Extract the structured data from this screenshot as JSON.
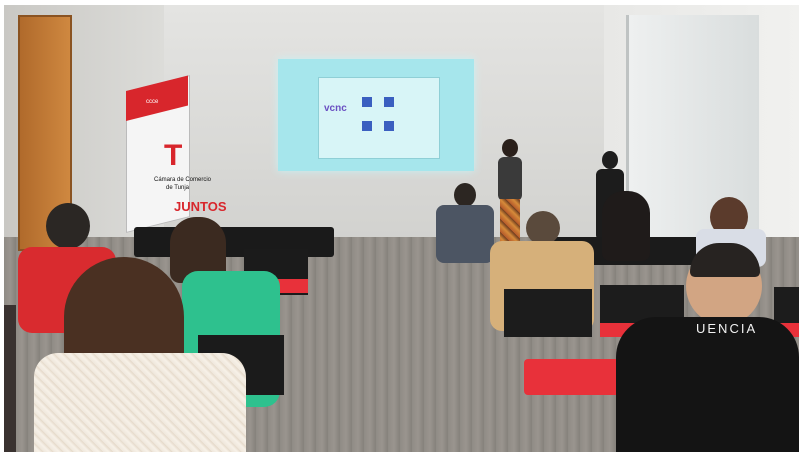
{
  "photo": {
    "banner": {
      "logo_letter": "T",
      "top_text": "ccce",
      "org_line1": "Cámara de Comercio",
      "org_line2": "de Tunja",
      "slogan": "JUNTOS"
    },
    "projection": {
      "logo_text": "vcnc"
    },
    "clothing_text": "UENCIA"
  },
  "colors": {
    "wall": "#d9d9d7",
    "floor": "#8f8b85",
    "screen": "#9fe3ea",
    "banner_red": "#d8262c",
    "chair_red": "#e8313a",
    "door": "#c27a33"
  }
}
